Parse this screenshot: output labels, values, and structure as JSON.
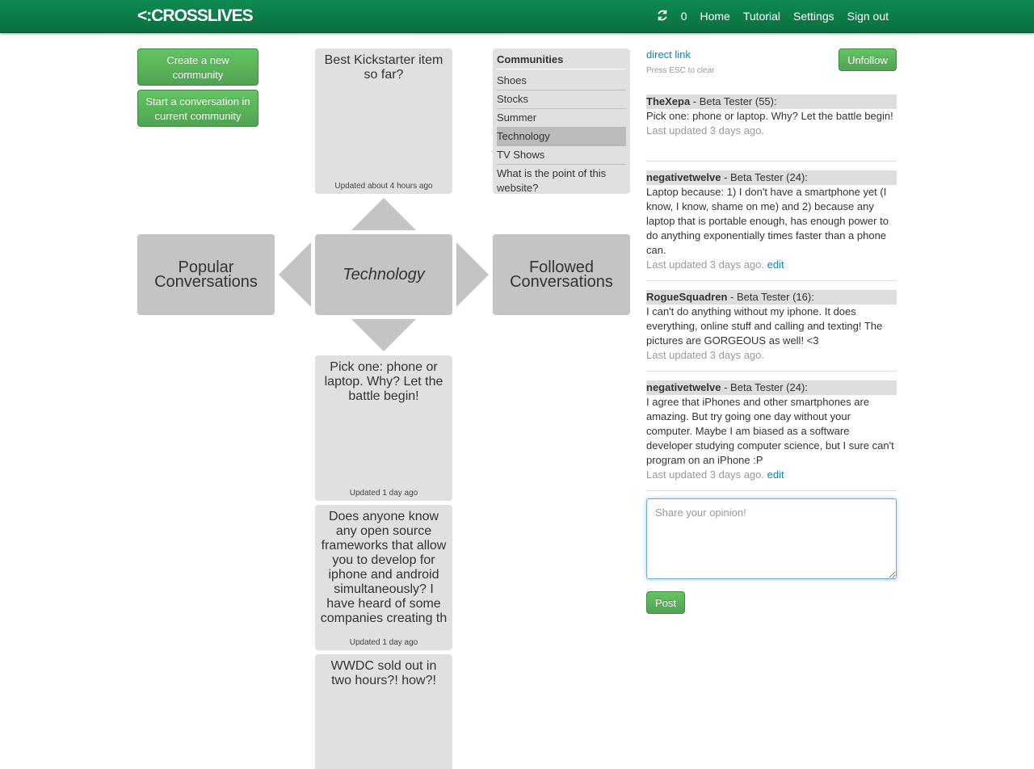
{
  "navbar": {
    "brand": "<:CROSSLIVES",
    "count": "0",
    "links": [
      "Home",
      "Tutorial",
      "Settings",
      "Sign out"
    ]
  },
  "actions": {
    "create_community": "Create a new community",
    "start_conversation": "Start a conversation in current community"
  },
  "top_conversation": {
    "title": "Best Kickstarter item so far?",
    "updated": "Updated about 4 hours ago"
  },
  "nav_tiles": {
    "popular": "Popular Conversations",
    "current": "Technology",
    "followed": "Followed Conversations"
  },
  "conversations": [
    {
      "title": "Pick one: phone or laptop. Why? Let the battle begin!",
      "updated": "Updated 1 day ago"
    },
    {
      "title": "Does anyone know any open source frameworks that allow you to develop for iphone and android simultaneously? I have heard of some companies creating th",
      "updated": "Updated 1 day ago"
    },
    {
      "title": "WWDC sold out in two hours?! how?!",
      "updated": ""
    }
  ],
  "communities": {
    "heading": "Communities",
    "items": [
      "Shoes",
      "Stocks",
      "Summer",
      "Technology",
      "TV Shows",
      "What is the point of this website?"
    ],
    "active_index": 3
  },
  "detail": {
    "direct_link": "direct link",
    "esc_hint": "Press ESC to clear",
    "unfollow": "Unfollow",
    "posts": [
      {
        "author": "TheXepa",
        "role": " - Beta Tester (55):",
        "body": "Pick one: phone or laptop. Why? Let the battle begin!",
        "meta": "Last updated 3 days ago.",
        "edit": ""
      },
      {
        "author": "negativetwelve",
        "role": " - Beta Tester (24):",
        "body": "Laptop because: 1) I don't have a smartphone yet (I know, I know, shame on me) and 2) because any laptop that is portable enough, has enough power to do anything exponentially times faster than a phone can.",
        "meta": "Last updated 3 days ago.",
        "edit": "edit"
      },
      {
        "author": "RogueSquadren",
        "role": " - Beta Tester (16):",
        "body": "I can't do anything without my iphone. It does everything, online stuff and calling and texting! The pictures are GORGEOUS as well! <3",
        "meta": "Last updated 3 days ago.",
        "edit": ""
      },
      {
        "author": "negativetwelve",
        "role": " - Beta Tester (24):",
        "body": "I agree that iPhones and other smartphones are amazing. But try going one day without your computer. Maybe I am biased as a software developer studying computer science, but I sure can't program on an iPhone :P",
        "meta": "Last updated 3 days ago.",
        "edit": "edit"
      }
    ],
    "reply_placeholder": "Share your opinion!",
    "post_button": "Post"
  }
}
